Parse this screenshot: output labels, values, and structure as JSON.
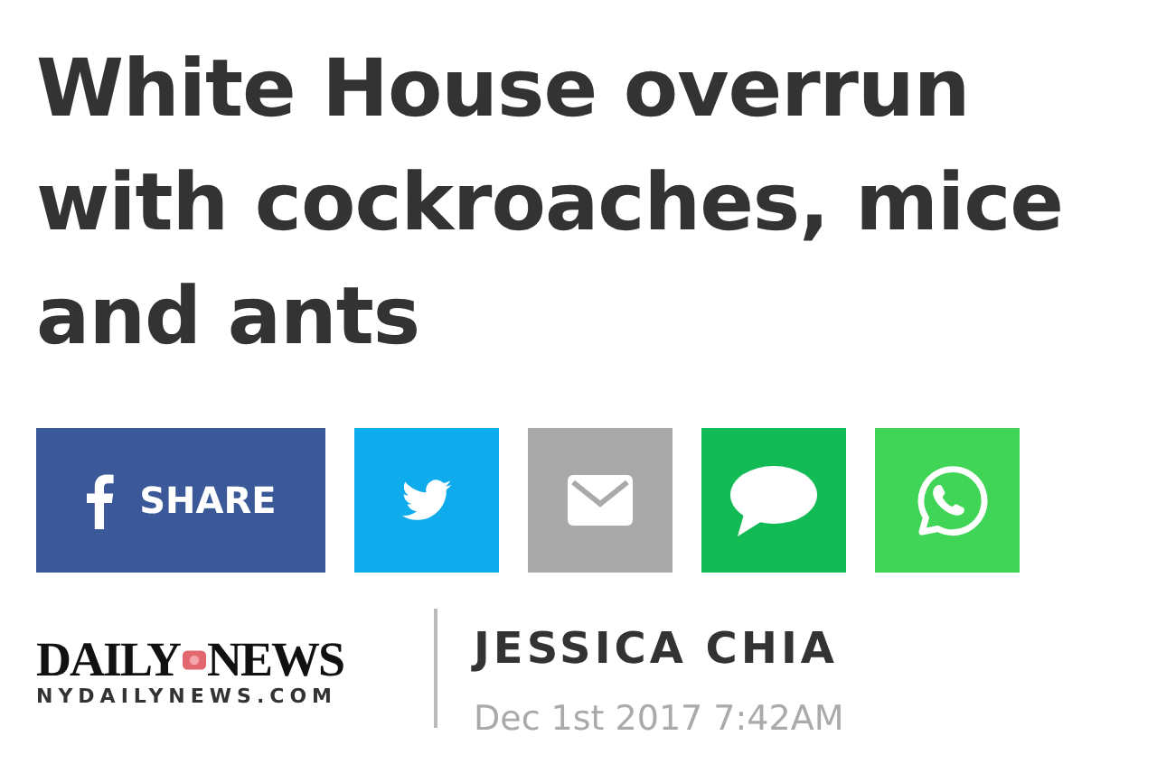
{
  "headline": "White House overrun with cockroaches, mice and ants",
  "share_buttons": [
    {
      "kind": "facebook",
      "label": "SHARE"
    },
    {
      "kind": "twitter"
    },
    {
      "kind": "email"
    },
    {
      "kind": "message"
    },
    {
      "kind": "whatsapp"
    }
  ],
  "publisher": {
    "name_left": "DAILY",
    "name_right": "NEWS",
    "url": "NYDAILYNEWS.COM"
  },
  "author": "JESSICA CHIA",
  "date": "Dec 1st 2017 7:42AM"
}
